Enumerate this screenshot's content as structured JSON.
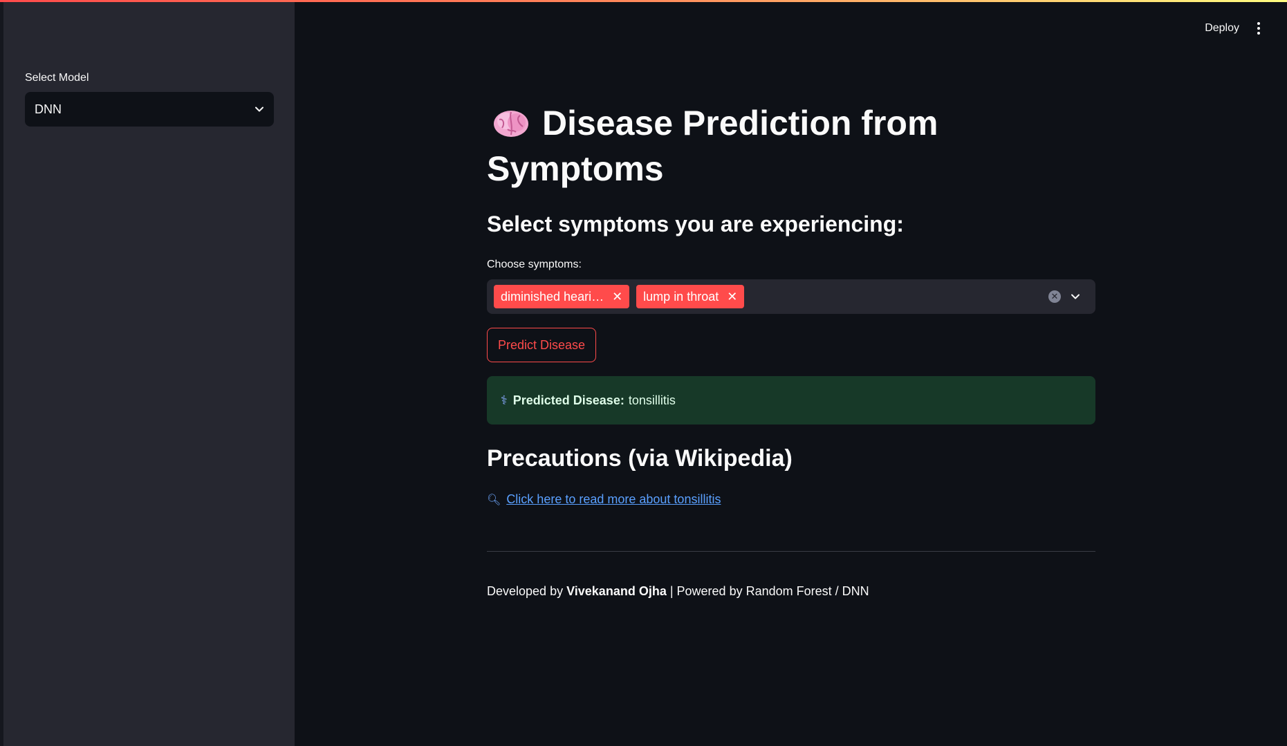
{
  "header": {
    "deploy_label": "Deploy",
    "menu_icon": "kebab-menu-icon"
  },
  "sidebar": {
    "model_label": "Select Model",
    "model_value": "DNN"
  },
  "main": {
    "title": "Disease Prediction from Symptoms",
    "title_icon": "brain-icon",
    "subtitle": "Select symptoms you are experiencing:",
    "symptoms_label": "Choose symptoms:",
    "selected_symptoms": [
      "diminished heari…",
      "lump in throat"
    ],
    "predict_button": "Predict Disease",
    "result_label": "Predicted Disease:",
    "result_value": "tonsillitis",
    "precautions_title": "Precautions (via Wikipedia)",
    "link_text": "Click here to read more about tonsillitis",
    "footer_prefix": "Developed by",
    "footer_author": "Vivekanand Ojha",
    "footer_suffix": "| Powered by Random Forest / DNN"
  },
  "colors": {
    "accent": "#ff4b4b",
    "background": "#0e1117",
    "sidebar": "#262730",
    "success_bg": "#173928",
    "link": "#5aa0ff"
  }
}
